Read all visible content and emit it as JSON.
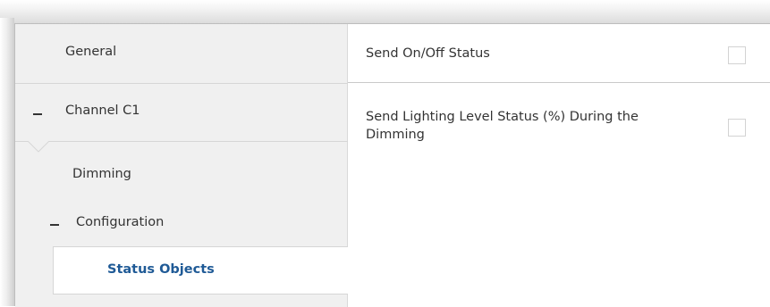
{
  "sidebar": {
    "items": [
      {
        "label": "General"
      },
      {
        "label": "Channel C1",
        "expanded": true
      },
      {
        "label": "Dimming"
      },
      {
        "label": "Configuration",
        "expanded": true
      },
      {
        "label": "Status Objects",
        "selected": true
      }
    ]
  },
  "content": {
    "rows": [
      {
        "label": "Send On/Off Status",
        "checked": false
      },
      {
        "label": "Send Lighting Level Status (%) During the Dimming",
        "checked": false
      }
    ]
  },
  "colors": {
    "selected_text": "#1f5a96",
    "sidebar_bg": "#f0f0f0",
    "panel_bg": "#ffffff"
  },
  "icons": {
    "collapse": "minus-icon",
    "checkbox": "checkbox-unchecked"
  }
}
